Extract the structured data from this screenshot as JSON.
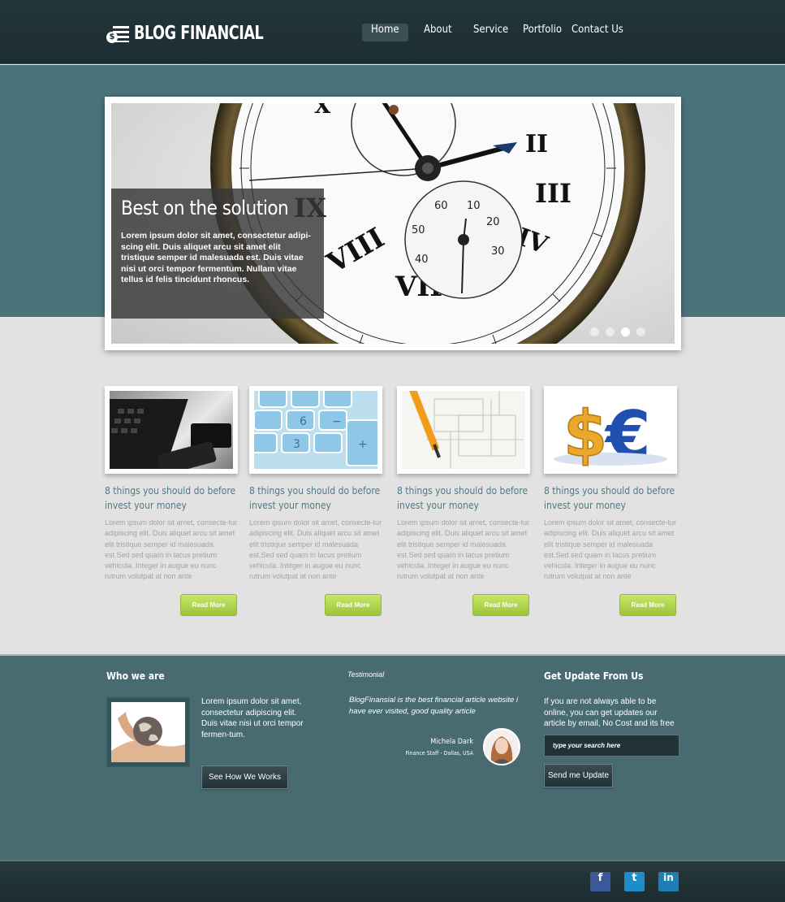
{
  "header": {
    "logo_text": "BLOG FINANCIAL",
    "nav": [
      {
        "label": "Home",
        "active": true
      },
      {
        "label": "About"
      },
      {
        "label": "Service"
      },
      {
        "label": "Portfolio"
      },
      {
        "label": "Contact Us"
      }
    ]
  },
  "slider": {
    "title": "Best on the solution",
    "text": "Lorem ipsum dolor sit amet, consectetur adipi-scing elit. Duis aliquet arcu sit amet elit tristique semper id malesuada est. Duis vitae nisi ut orci tempor fermentum. Nullam vitae tellus id felis tincidunt rhoncus.",
    "slide_count": 4,
    "active_slide": 3
  },
  "articles": [
    {
      "title": "8 things you should do before invest your money",
      "excerpt": "Lorem ipsum dolor sit amet, consecte-tur adipiscing elit. Duis aliquet arcu sit amet elit tristique semper id malesuada est.Sed sed quam in lacus pretium vehicula. Integer in augue eu nunc rutrum volutpat at non ante",
      "button": "Read More",
      "image": "keyboard-phone"
    },
    {
      "title": "8 things you should do before invest your money",
      "excerpt": "Lorem ipsum dolor sit amet, consecte-tur adipiscing elit. Duis aliquet arcu sit amet elit tristique semper id malesuada est.Sed sed quam in lacus pretium vehicula. Integer in augue eu nunc rutrum volutpat at non ante",
      "button": "Read More",
      "image": "calculator"
    },
    {
      "title": "8 things you should do before invest your money",
      "excerpt": "Lorem ipsum dolor sit amet, consecte-tur adipiscing elit. Duis aliquet arcu sit amet elit tristique semper id malesuada est.Sed sed quam in lacus pretium vehicula. Integer in augue eu nunc rutrum volutpat at non ante",
      "button": "Read More",
      "image": "pencil-blueprint"
    },
    {
      "title": "8 things you should do before invest your money",
      "excerpt": "Lorem ipsum dolor sit amet, consecte-tur adipiscing elit. Duis aliquet arcu sit amet elit tristique semper id malesuada est.Sed sed quam in lacus pretium vehicula. Integer in augue eu nunc rutrum volutpat at non ante",
      "button": "Read More",
      "image": "currency-symbols"
    }
  ],
  "who": {
    "heading": "Who we are",
    "text": "Lorem ipsum dolor sit amet, consectetur adipiscing elit. Duis vitae nisi ut orci tempor fermen-tum.",
    "button": "See How We Works"
  },
  "testimonial": {
    "heading": "Testimonial",
    "quote": "BlogFinansial is the best financial article website i have ever visited, good quality article",
    "name": "Michela Dark",
    "role": "Finance Staff - Dallas, USA"
  },
  "update": {
    "heading": "Get Update From Us",
    "text": "If you are not always able to be online, you can get updates our article by email, No Cost and its free",
    "placeholder": "type your search here",
    "button": "Send me Update"
  },
  "social": [
    {
      "name": "facebook",
      "glyph": "f",
      "color": "#3b5998"
    },
    {
      "name": "twitter",
      "glyph": "t",
      "color": "#1e8cc9"
    },
    {
      "name": "linkedin",
      "glyph": "in",
      "color": "#1f7fb5"
    }
  ],
  "colors": {
    "teal": "#4a737a",
    "dark": "#1d2e33",
    "accent_green": "#9bc53a",
    "title_blue": "#4c7a86"
  }
}
